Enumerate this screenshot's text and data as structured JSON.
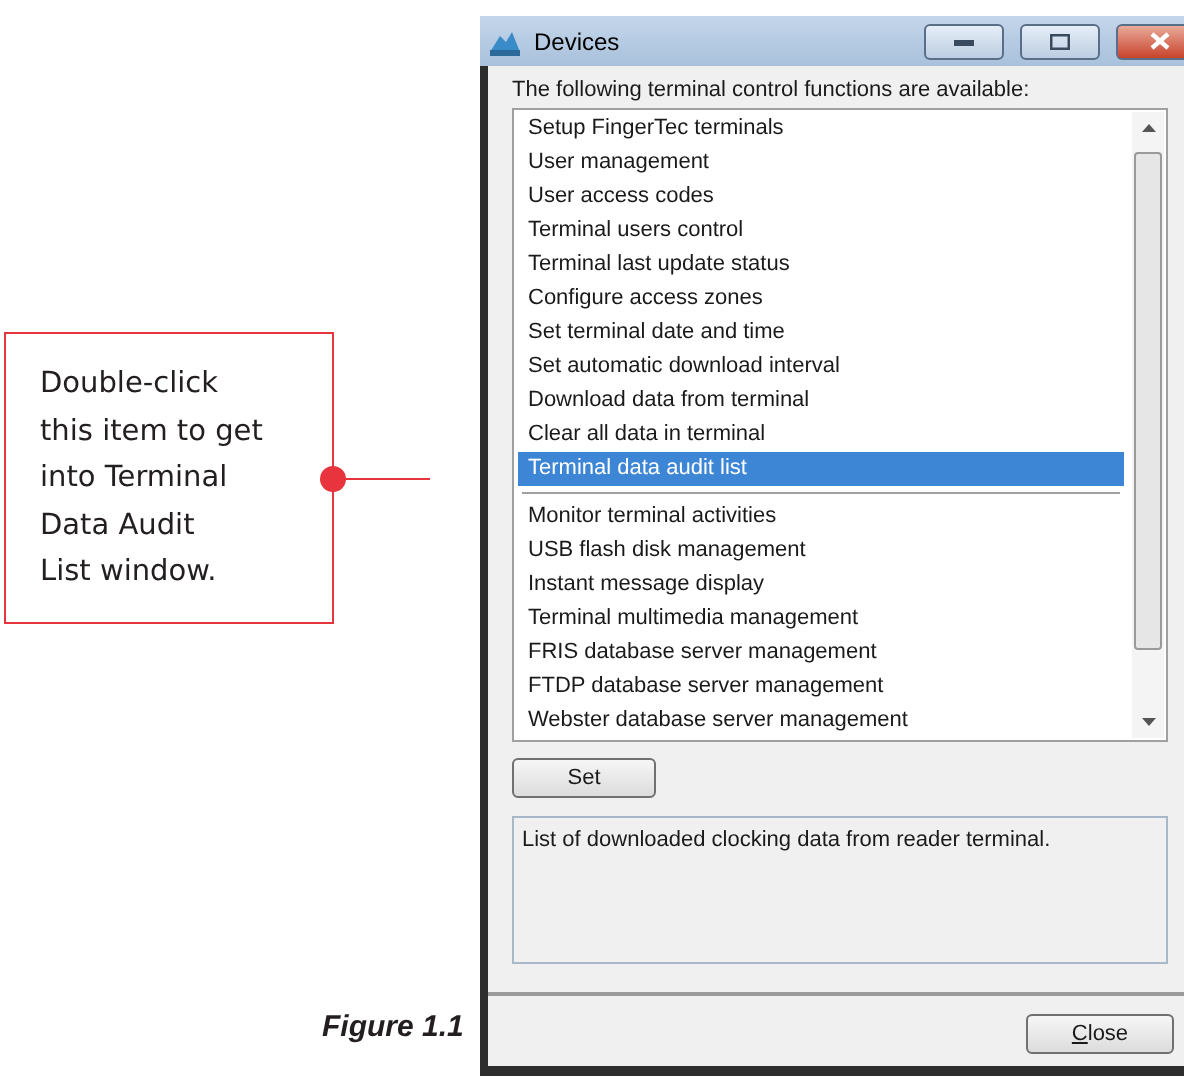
{
  "callout": {
    "lines": [
      "Double-click",
      "this item to get",
      "into Terminal",
      "Data Audit",
      "List window."
    ]
  },
  "caption": "Figure 1.1",
  "window": {
    "title": "Devices"
  },
  "list_label": "The following terminal control functions are available:",
  "functions": [
    {
      "kind": "item",
      "label": "Setup FingerTec terminals",
      "selected": false
    },
    {
      "kind": "item",
      "label": "User management",
      "selected": false
    },
    {
      "kind": "item",
      "label": "User access codes",
      "selected": false
    },
    {
      "kind": "item",
      "label": "Terminal users control",
      "selected": false
    },
    {
      "kind": "item",
      "label": "Terminal last update status",
      "selected": false
    },
    {
      "kind": "item",
      "label": "Configure access zones",
      "selected": false
    },
    {
      "kind": "item",
      "label": "Set terminal date and time",
      "selected": false
    },
    {
      "kind": "item",
      "label": "Set automatic download interval",
      "selected": false
    },
    {
      "kind": "item",
      "label": "Download data from terminal",
      "selected": false
    },
    {
      "kind": "item",
      "label": "Clear all data in terminal",
      "selected": false
    },
    {
      "kind": "item",
      "label": "Terminal data audit list",
      "selected": true
    },
    {
      "kind": "separator"
    },
    {
      "kind": "item",
      "label": "Monitor terminal activities",
      "selected": false
    },
    {
      "kind": "item",
      "label": "USB flash disk management",
      "selected": false
    },
    {
      "kind": "item",
      "label": "Instant message display",
      "selected": false
    },
    {
      "kind": "item",
      "label": "Terminal multimedia management",
      "selected": false
    },
    {
      "kind": "item",
      "label": "FRIS database server management",
      "selected": false
    },
    {
      "kind": "item",
      "label": "FTDP database server management",
      "selected": false
    },
    {
      "kind": "item",
      "label": "Webster database server management",
      "selected": false
    }
  ],
  "set_button": "Set",
  "description": "List of downloaded clocking data from reader terminal.",
  "close_button": "Close"
}
